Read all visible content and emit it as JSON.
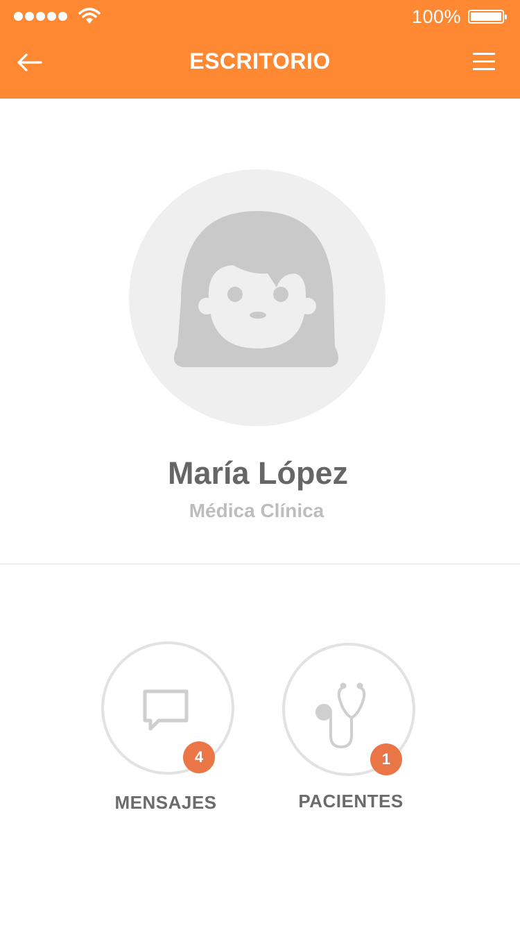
{
  "status_bar": {
    "battery_percent": "100%",
    "signal_bars": 5
  },
  "header": {
    "title": "ESCRITORIO",
    "back_icon": "arrow-left-icon",
    "menu_icon": "hamburger-menu-icon",
    "background_color": "#ff8833"
  },
  "profile": {
    "name": "María López",
    "role": "Médica Clínica",
    "avatar_icon": "female-avatar-icon"
  },
  "actions": [
    {
      "label": "MENSAJES",
      "icon": "chat-bubble-icon",
      "badge": "4"
    },
    {
      "label": "PACIENTES",
      "icon": "stethoscope-icon",
      "badge": "1"
    }
  ],
  "colors": {
    "accent": "#ff8833",
    "badge": "#ea7547"
  }
}
